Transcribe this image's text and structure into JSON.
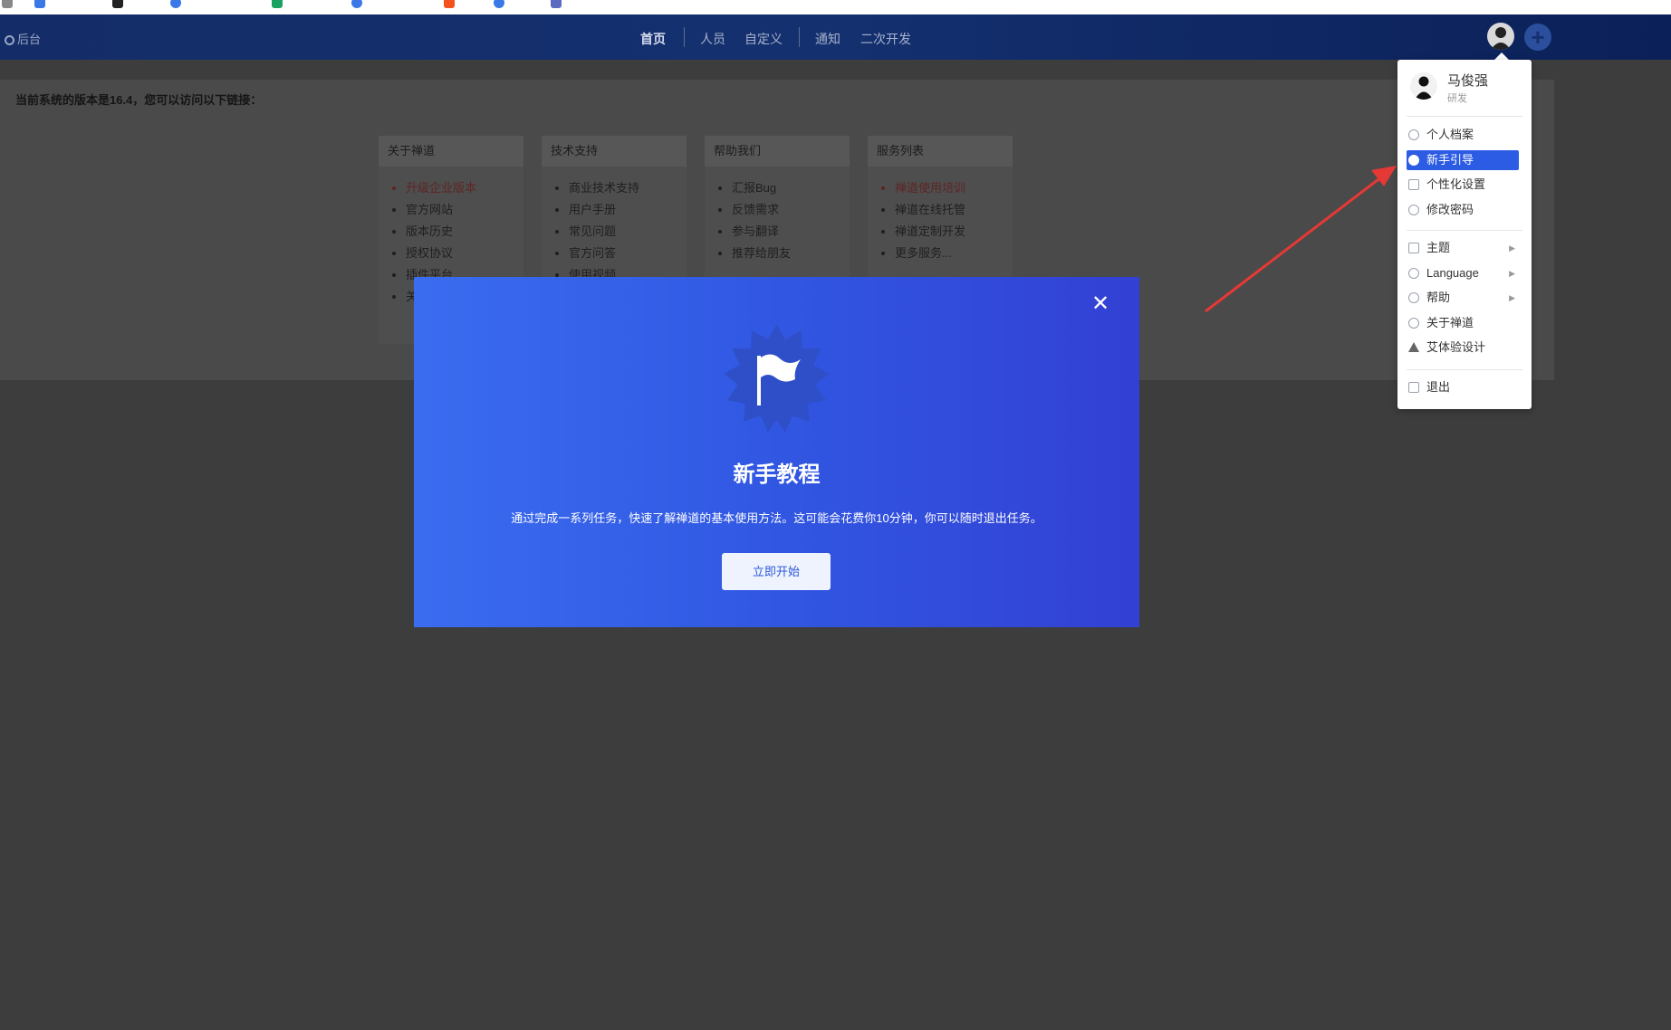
{
  "bookmarks": [
    "",
    "",
    "",
    "",
    "",
    "",
    "",
    "",
    "",
    "",
    ""
  ],
  "topnav": {
    "admin_label": "后台",
    "items": [
      "首页",
      "人员",
      "自定义",
      "通知",
      "二次开发"
    ]
  },
  "main": {
    "version_text": "当前系统的版本是16.4，您可以访问以下链接：",
    "columns": [
      {
        "title": "关于禅道",
        "links": [
          "升级企业版本",
          "官方网站",
          "版本历史",
          "授权协议",
          "插件平台",
          "关"
        ]
      },
      {
        "title": "技术支持",
        "links": [
          "商业技术支持",
          "用户手册",
          "常见问题",
          "官方问答",
          "使用视频"
        ]
      },
      {
        "title": "帮助我们",
        "links": [
          "汇报Bug",
          "反馈需求",
          "参与翻译",
          "推荐给朋友"
        ]
      },
      {
        "title": "服务列表",
        "links": [
          "禅道使用培训",
          "禅道在线托管",
          "禅道定制开发",
          "更多服务..."
        ]
      }
    ]
  },
  "modal": {
    "close_label": "✕",
    "title": "新手教程",
    "description": "通过完成一系列任务，快速了解禅道的基本使用方法。这可能会花费你10分钟，你可以随时退出任务。",
    "start_button": "立即开始"
  },
  "user_menu": {
    "name": "马俊强",
    "role": "研发",
    "items": [
      {
        "label": "个人档案",
        "icon": "user-circle-icon"
      },
      {
        "label": "新手引导",
        "icon": "guide-icon",
        "active": true
      },
      {
        "label": "个性化设置",
        "icon": "list-settings-icon"
      },
      {
        "label": "修改密码",
        "icon": "gear-icon"
      },
      {
        "label": "主题",
        "icon": "shirt-icon",
        "submenu": true
      },
      {
        "label": "Language",
        "icon": "globe-icon",
        "submenu": true
      },
      {
        "label": "帮助",
        "icon": "question-icon",
        "submenu": true
      },
      {
        "label": "关于禅道",
        "icon": "info-icon"
      },
      {
        "label": "艾体验设计",
        "icon": "a-logo-icon"
      },
      {
        "label": "退出",
        "icon": "exit-icon"
      }
    ]
  },
  "colors": {
    "nav_bg": "#14306f",
    "modal_start": "#3a6cf0",
    "modal_end": "#3240d4",
    "active_item": "#2c5be4",
    "annotation_arrow": "#e53935",
    "link_red": "#d23c3c"
  }
}
